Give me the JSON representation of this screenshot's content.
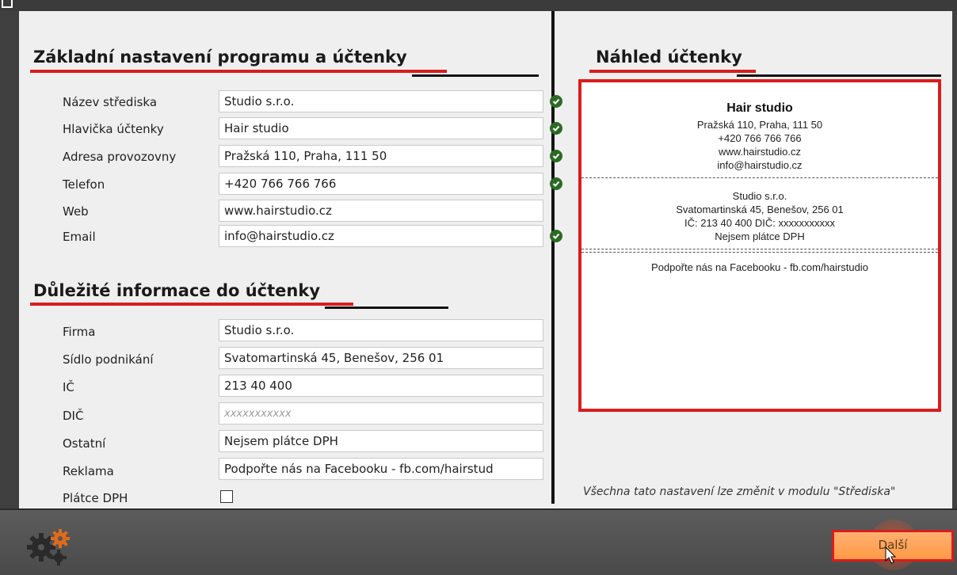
{
  "left_panel": {
    "basic_heading": "Základní nastavení programu a účtenky",
    "basic_fields": [
      {
        "label": "Název střediska",
        "value": "Studio s.r.o.",
        "valid": true
      },
      {
        "label": "Hlavička účtenky",
        "value": "Hair studio",
        "valid": true
      },
      {
        "label": "Adresa provozovny",
        "value": "Pražská 110, Praha, 111 50",
        "valid": true
      },
      {
        "label": "Telefon",
        "value": "+420 766 766 766",
        "valid": true
      },
      {
        "label": "Web",
        "value": "www.hairstudio.cz",
        "valid": false
      },
      {
        "label": "Email",
        "value": "info@hairstudio.cz",
        "valid": true
      }
    ],
    "important_heading": "Důležité informace do účtenky",
    "important_fields": [
      {
        "label": "Firma",
        "value": "Studio s.r.o."
      },
      {
        "label": "Sídlo podnikání",
        "value": "Svatomartinská 45, Benešov, 256 01"
      },
      {
        "label": "IČ",
        "value": "213 40 400"
      },
      {
        "label": "DIČ",
        "value": "",
        "placeholder": "xxxxxxxxxxx"
      },
      {
        "label": "Ostatní",
        "value": "Nejsem plátce DPH"
      },
      {
        "label": "Reklama",
        "value": "Podpořte nás na Facebooku - fb.com/hairstud"
      }
    ],
    "vat_payer_label": "Plátce DPH",
    "vat_payer_checked": false
  },
  "preview": {
    "heading": "Náhled účtenky",
    "header_lines": [
      "Hair studio",
      "Pražská 110, Praha, 111 50",
      "+420 766 766 766",
      "www.hairstudio.cz",
      "info@hairstudio.cz"
    ],
    "company_lines": [
      "Studio s.r.o.",
      "Svatomartinská 45, Benešov, 256 01",
      "IČ: 213 40 400 DIČ: xxxxxxxxxxx",
      "Nejsem plátce DPH"
    ],
    "ad_line": "Podpořte nás na Facebooku - fb.com/hairstudio",
    "footnote": "Všechna tato nastavení lze změnit v modulu \"Střediska\""
  },
  "bottom_bar": {
    "settings_icon": "gears-icon",
    "next_label": "Další"
  },
  "colors": {
    "accent_red": "#d81d1d",
    "check_green": "#2d6a25",
    "next_button": "#ff9a48"
  }
}
